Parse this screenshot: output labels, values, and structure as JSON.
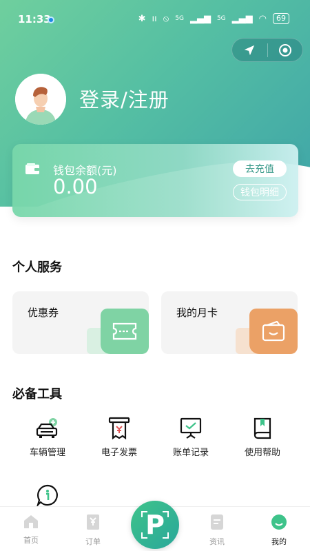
{
  "status_bar": {
    "time": "11:33",
    "battery": "69",
    "signal_1": "5G",
    "signal_2": "5G"
  },
  "profile": {
    "login_text": "登录/注册"
  },
  "wallet": {
    "label": "钱包余额(元)",
    "amount": "0.00",
    "recharge_label": "去充值",
    "detail_label": "钱包明细"
  },
  "personal_services": {
    "title": "个人服务",
    "items": [
      {
        "label": "优惠券",
        "color": "#7fd3a4"
      },
      {
        "label": "我的月卡",
        "color": "#eba166"
      }
    ]
  },
  "tools": {
    "title": "必备工具",
    "items": [
      {
        "label": "车辆管理",
        "icon": "car-icon"
      },
      {
        "label": "电子发票",
        "icon": "invoice-icon"
      },
      {
        "label": "账单记录",
        "icon": "bill-icon"
      },
      {
        "label": "使用帮助",
        "icon": "help-book-icon"
      },
      {
        "label": "",
        "icon": "info-chat-icon"
      }
    ]
  },
  "tabbar": {
    "items": [
      {
        "label": "首页",
        "icon": "home-icon"
      },
      {
        "label": "订单",
        "icon": "order-icon"
      },
      {
        "label": "资讯",
        "icon": "news-icon"
      },
      {
        "label": "我的",
        "icon": "profile-icon"
      }
    ],
    "center_label": "P",
    "active": "我的"
  },
  "colors": {
    "accent": "#3ec38a",
    "hero_start": "#6fcf9e",
    "hero_end": "#3fa5a8"
  }
}
